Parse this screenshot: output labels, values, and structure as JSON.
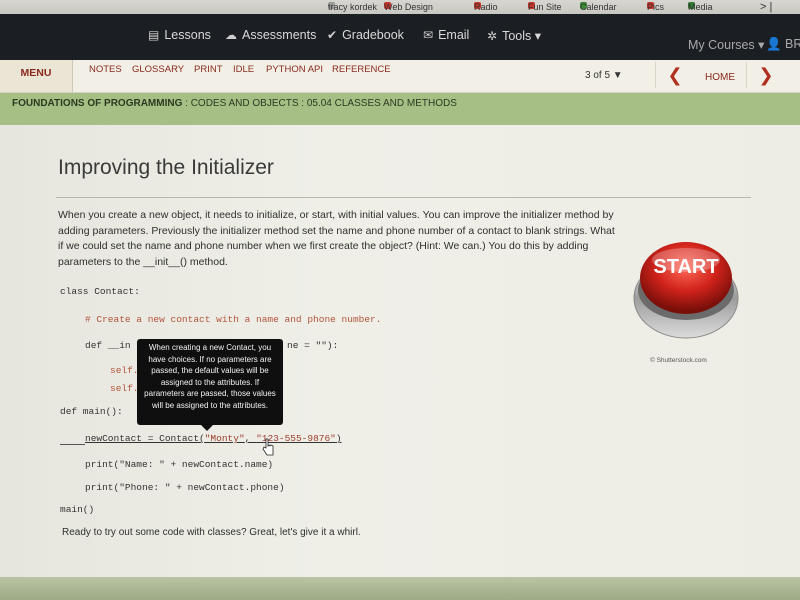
{
  "bookmarks": [
    {
      "label": "tracy kordek",
      "color": "#999999"
    },
    {
      "label": "Web Design",
      "color": "#c8352a"
    },
    {
      "label": "Radio",
      "color": "#c8352a"
    },
    {
      "label": "Fun Site",
      "color": "#c8352a"
    },
    {
      "label": "Calendar",
      "color": "#3a8a3a"
    },
    {
      "label": "Pics",
      "color": "#c8352a"
    },
    {
      "label": "Media",
      "color": "#2e7d32"
    }
  ],
  "topnav": {
    "items": [
      {
        "label": "Lessons",
        "icon": "monitor-icon",
        "glyph": "▤"
      },
      {
        "label": "Assessments",
        "icon": "cloud-icon",
        "glyph": "☁"
      },
      {
        "label": "Gradebook",
        "icon": "check-icon",
        "glyph": "✔"
      },
      {
        "label": "Email",
        "icon": "envelope-icon",
        "glyph": "✉"
      },
      {
        "label": "Tools ▾",
        "icon": "gear-icon",
        "glyph": "✲"
      }
    ],
    "my_courses": "My Courses ▾",
    "user": "👤 BRA"
  },
  "menubar": {
    "menu_label": "MENU",
    "links": [
      "NOTES",
      "GLOSSARY",
      "PRINT",
      "IDLE",
      "PYTHON API",
      "REFERENCE"
    ],
    "pager": "3 of 5 ▼",
    "prev": "❮",
    "home": "HOME",
    "next": "❯"
  },
  "breadcrumb": {
    "course": "FOUNDATIONS OF PROGRAMMING",
    "path": " : CODES AND OBJECTS : 05.04 CLASSES AND METHODS"
  },
  "lesson": {
    "title": "Improving the Initializer",
    "intro": "When you create a new object, it needs to initialize, or start, with initial values. You can improve the initializer method by adding parameters. Previously the initializer method set the name and phone number of a contact to blank strings. What if we could set the name and phone number when we first create the object? (Hint: We can.) You do this by adding parameters to the __init__() method.",
    "code": {
      "line1": "class Contact:",
      "line2": "# Create a new contact with a name and phone number.",
      "line3a": "def __in",
      "line3b": "ne = \"\"):",
      "line4": "self.",
      "line5": "self.",
      "line6": "def main():",
      "line7a": "newContact = Contact(",
      "line7b": "\"Monty\"",
      "line7c": ", ",
      "line7d": "\"123-555-9876\"",
      "line7e": ")",
      "line8": "print(\"Name: \" + newContact.name)",
      "line9": "print(\"Phone: \" + newContact.phone)",
      "line10": "main()"
    },
    "outro": "Ready to try out some code with classes? Great, let's give it a whirl.",
    "image_text": "START",
    "credit": "© Shutterstock.com"
  },
  "tooltip": {
    "text": "When creating a new Contact, you have choices. If no parameters are passed, the default values will be assigned to the attributes. If parameters are passed, those values will be assigned to the attributes."
  }
}
